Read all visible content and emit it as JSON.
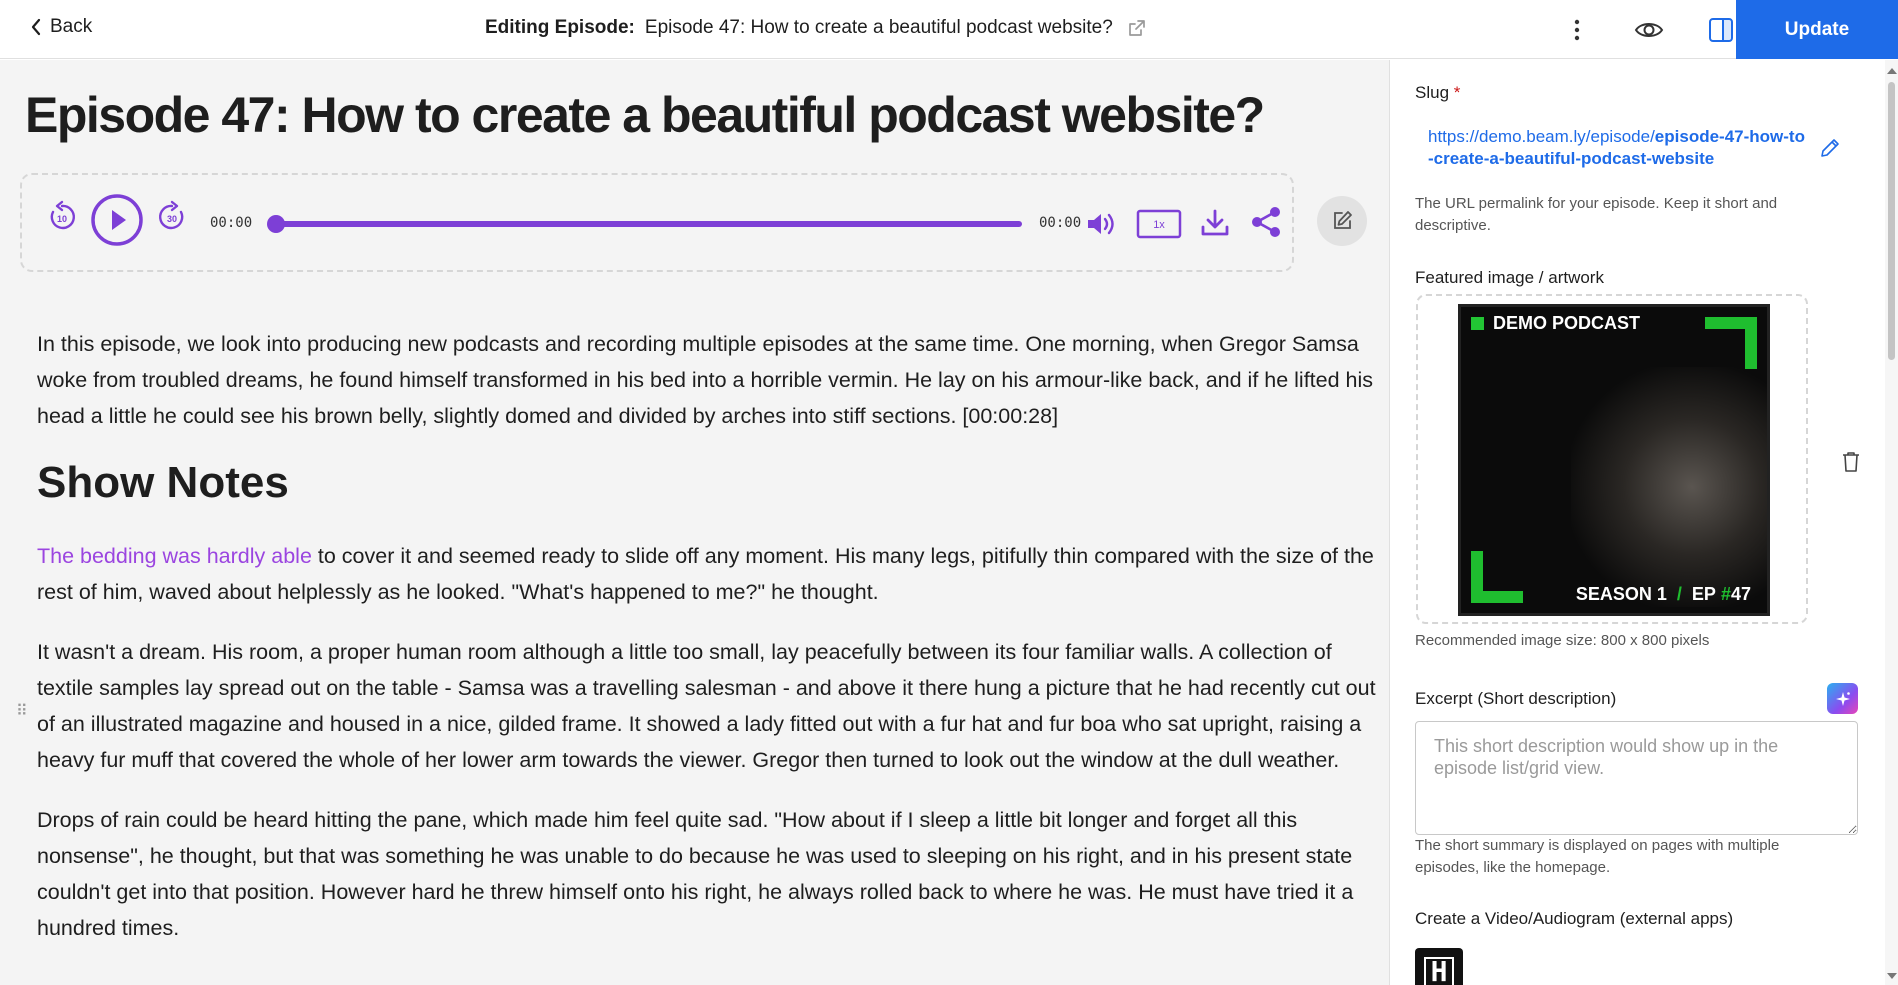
{
  "header": {
    "back_label": "Back",
    "editing_label": "Editing Episode:",
    "episode_title": "Episode 47: How to create a beautiful podcast website?",
    "update_label": "Update",
    "icons": [
      "external-link-icon",
      "more-vertical-icon",
      "eye-icon",
      "sidebar-toggle-icon"
    ]
  },
  "editor": {
    "title": "Episode 47: How to create a beautiful podcast website?",
    "player": {
      "rewind_seconds": "10",
      "forward_seconds": "30",
      "current_time": "00:00",
      "duration": "00:00",
      "speed": "1x",
      "progress": 0,
      "accent_color": "#7d3fd6"
    },
    "paragraph_1": "In this episode, we look into producing new podcasts and recording multiple episodes at the same time. One morning, when Gregor Samsa woke from troubled dreams, he found himself transformed in his bed into a horrible vermin. He lay on his armour-like back, and if he lifted his head a little he could see his brown belly, slightly domed and divided by arches into stiff sections. [00:00:28]",
    "heading": "Show Notes",
    "paragraph_2_link": "The bedding was hardly able",
    "paragraph_2_rest": " to cover it and seemed ready to slide off any moment. His many legs, pitifully thin compared with the size of the rest of him, waved about helplessly as he looked. \"What's happened to me?\" he thought.",
    "paragraph_3": "It wasn't a dream. His room, a proper human room although a little too small, lay peacefully between its four familiar walls. A collection of textile samples lay spread out on the table - Samsa was a travelling salesman - and above it there hung a picture that he had recently cut out of an illustrated magazine and housed in a nice, gilded frame. It showed a lady fitted out with a fur hat and fur boa who sat upright, raising a heavy fur muff that covered the whole of her lower arm towards the viewer. Gregor then turned to look out the window at the dull weather.",
    "paragraph_4": "Drops of rain could be heard hitting the pane, which made him feel quite sad. \"How about if I sleep a little bit longer and forget all this nonsense\", he thought, but that was something he was unable to do because he was used to sleeping on his right, and in his present state couldn't get into that position. However hard he threw himself onto his right, he always rolled back to where he was. He must have tried it a hundred times."
  },
  "sidebar": {
    "slug_label": "Slug",
    "slug_required": "*",
    "slug_base": "https://demo.beam.ly/episode/",
    "slug_value": "episode-47-how-to-create-a-beautiful-podcast-website",
    "slug_help": "The URL permalink for your episode. Keep it short and descriptive.",
    "featured_label": "Featured image / artwork",
    "artwork": {
      "brand": "DEMO PODCAST",
      "season": "SEASON 1",
      "slash": "/",
      "ep_prefix": "EP",
      "hash": "#",
      "ep_number": "47"
    },
    "image_help": "Recommended image size: 800 x 800 pixels",
    "excerpt_label": "Excerpt (Short description)",
    "excerpt_placeholder": "This short description would show up in the episode list/grid view.",
    "excerpt_value": "",
    "excerpt_help": "The short summary is displayed on pages with multiple episodes, like the homepage.",
    "video_label": "Create a Video/Audiogram (external apps)",
    "app_logo_letter": "H"
  },
  "colors": {
    "primary": "#1e6be8",
    "accent_purple": "#7d3fd6",
    "link_purple": "#9b45e0",
    "art_green": "#1fbe2f",
    "required_red": "#cc1818"
  }
}
